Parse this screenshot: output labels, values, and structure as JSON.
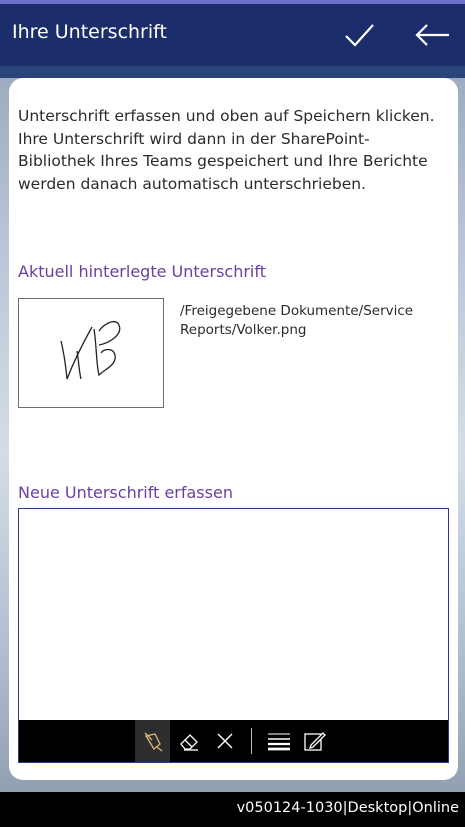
{
  "header": {
    "title": "Ihre Unterschrift",
    "save_icon": "check-icon",
    "back_icon": "arrow-left-icon"
  },
  "intro_text": "Unterschrift erfassen und oben auf Speichern klicken. Ihre Unterschrift wird dann in der SharePoint-Bibliothek Ihres Teams gespeichert und Ihre Berichte werden danach automatisch unterschrieben.",
  "current_signature": {
    "title": "Aktuell hinterlegte Unterschrift",
    "path": "/Freigegebene Dokumente/Service Reports/Volker.png"
  },
  "new_signature": {
    "title": "Neue Unterschrift erfassen",
    "toolbar": [
      "pen-icon",
      "eraser-icon",
      "clear-icon",
      "line-thickness-icon",
      "pen-color-icon"
    ]
  },
  "footer": {
    "status": "v050124-1030|Desktop|Online"
  },
  "colors": {
    "header_bg": "#1b2e6b",
    "accent_purple": "#6b3fa0",
    "pad_border": "#2d3a8c"
  }
}
